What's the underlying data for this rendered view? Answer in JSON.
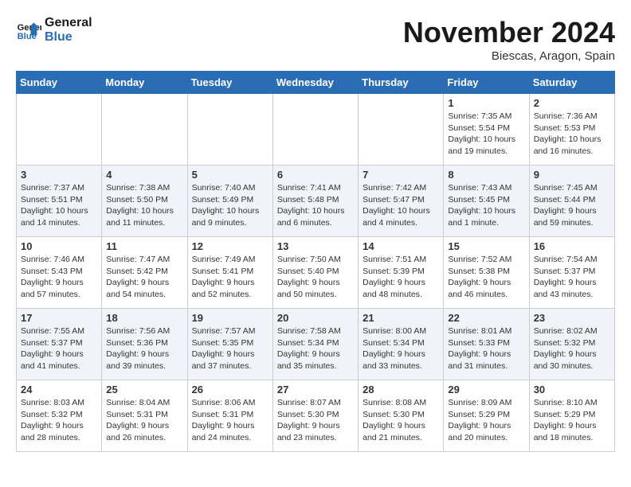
{
  "logo": {
    "line1": "General",
    "line2": "Blue"
  },
  "title": "November 2024",
  "subtitle": "Biescas, Aragon, Spain",
  "days_of_week": [
    "Sunday",
    "Monday",
    "Tuesday",
    "Wednesday",
    "Thursday",
    "Friday",
    "Saturday"
  ],
  "weeks": [
    [
      {
        "day": "",
        "info": ""
      },
      {
        "day": "",
        "info": ""
      },
      {
        "day": "",
        "info": ""
      },
      {
        "day": "",
        "info": ""
      },
      {
        "day": "",
        "info": ""
      },
      {
        "day": "1",
        "info": "Sunrise: 7:35 AM\nSunset: 5:54 PM\nDaylight: 10 hours and 19 minutes."
      },
      {
        "day": "2",
        "info": "Sunrise: 7:36 AM\nSunset: 5:53 PM\nDaylight: 10 hours and 16 minutes."
      }
    ],
    [
      {
        "day": "3",
        "info": "Sunrise: 7:37 AM\nSunset: 5:51 PM\nDaylight: 10 hours and 14 minutes."
      },
      {
        "day": "4",
        "info": "Sunrise: 7:38 AM\nSunset: 5:50 PM\nDaylight: 10 hours and 11 minutes."
      },
      {
        "day": "5",
        "info": "Sunrise: 7:40 AM\nSunset: 5:49 PM\nDaylight: 10 hours and 9 minutes."
      },
      {
        "day": "6",
        "info": "Sunrise: 7:41 AM\nSunset: 5:48 PM\nDaylight: 10 hours and 6 minutes."
      },
      {
        "day": "7",
        "info": "Sunrise: 7:42 AM\nSunset: 5:47 PM\nDaylight: 10 hours and 4 minutes."
      },
      {
        "day": "8",
        "info": "Sunrise: 7:43 AM\nSunset: 5:45 PM\nDaylight: 10 hours and 1 minute."
      },
      {
        "day": "9",
        "info": "Sunrise: 7:45 AM\nSunset: 5:44 PM\nDaylight: 9 hours and 59 minutes."
      }
    ],
    [
      {
        "day": "10",
        "info": "Sunrise: 7:46 AM\nSunset: 5:43 PM\nDaylight: 9 hours and 57 minutes."
      },
      {
        "day": "11",
        "info": "Sunrise: 7:47 AM\nSunset: 5:42 PM\nDaylight: 9 hours and 54 minutes."
      },
      {
        "day": "12",
        "info": "Sunrise: 7:49 AM\nSunset: 5:41 PM\nDaylight: 9 hours and 52 minutes."
      },
      {
        "day": "13",
        "info": "Sunrise: 7:50 AM\nSunset: 5:40 PM\nDaylight: 9 hours and 50 minutes."
      },
      {
        "day": "14",
        "info": "Sunrise: 7:51 AM\nSunset: 5:39 PM\nDaylight: 9 hours and 48 minutes."
      },
      {
        "day": "15",
        "info": "Sunrise: 7:52 AM\nSunset: 5:38 PM\nDaylight: 9 hours and 46 minutes."
      },
      {
        "day": "16",
        "info": "Sunrise: 7:54 AM\nSunset: 5:37 PM\nDaylight: 9 hours and 43 minutes."
      }
    ],
    [
      {
        "day": "17",
        "info": "Sunrise: 7:55 AM\nSunset: 5:37 PM\nDaylight: 9 hours and 41 minutes."
      },
      {
        "day": "18",
        "info": "Sunrise: 7:56 AM\nSunset: 5:36 PM\nDaylight: 9 hours and 39 minutes."
      },
      {
        "day": "19",
        "info": "Sunrise: 7:57 AM\nSunset: 5:35 PM\nDaylight: 9 hours and 37 minutes."
      },
      {
        "day": "20",
        "info": "Sunrise: 7:58 AM\nSunset: 5:34 PM\nDaylight: 9 hours and 35 minutes."
      },
      {
        "day": "21",
        "info": "Sunrise: 8:00 AM\nSunset: 5:34 PM\nDaylight: 9 hours and 33 minutes."
      },
      {
        "day": "22",
        "info": "Sunrise: 8:01 AM\nSunset: 5:33 PM\nDaylight: 9 hours and 31 minutes."
      },
      {
        "day": "23",
        "info": "Sunrise: 8:02 AM\nSunset: 5:32 PM\nDaylight: 9 hours and 30 minutes."
      }
    ],
    [
      {
        "day": "24",
        "info": "Sunrise: 8:03 AM\nSunset: 5:32 PM\nDaylight: 9 hours and 28 minutes."
      },
      {
        "day": "25",
        "info": "Sunrise: 8:04 AM\nSunset: 5:31 PM\nDaylight: 9 hours and 26 minutes."
      },
      {
        "day": "26",
        "info": "Sunrise: 8:06 AM\nSunset: 5:31 PM\nDaylight: 9 hours and 24 minutes."
      },
      {
        "day": "27",
        "info": "Sunrise: 8:07 AM\nSunset: 5:30 PM\nDaylight: 9 hours and 23 minutes."
      },
      {
        "day": "28",
        "info": "Sunrise: 8:08 AM\nSunset: 5:30 PM\nDaylight: 9 hours and 21 minutes."
      },
      {
        "day": "29",
        "info": "Sunrise: 8:09 AM\nSunset: 5:29 PM\nDaylight: 9 hours and 20 minutes."
      },
      {
        "day": "30",
        "info": "Sunrise: 8:10 AM\nSunset: 5:29 PM\nDaylight: 9 hours and 18 minutes."
      }
    ]
  ]
}
